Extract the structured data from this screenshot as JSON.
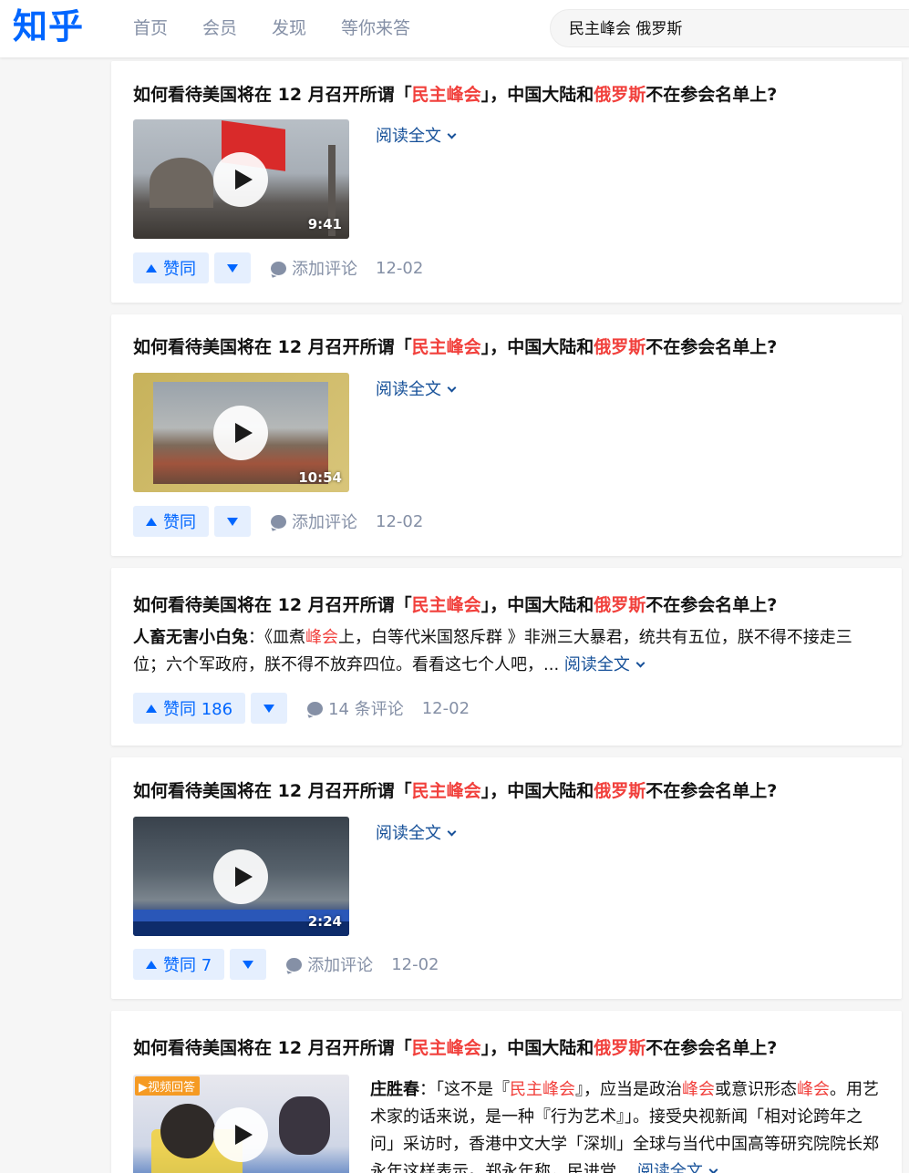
{
  "header": {
    "logo": "知乎",
    "nav": [
      "首页",
      "会员",
      "发现",
      "等你来答"
    ],
    "search_value": "民主峰会 俄罗斯"
  },
  "title_parts": {
    "pre": "如何看待美国将在 12 月召开所谓「",
    "hl1": "民主峰会",
    "mid": "」，中国大陆和",
    "hl2": "俄罗斯",
    "post": "不在参会名单上?"
  },
  "cards": [
    {
      "duration": "9:41",
      "read_more": "阅读全文",
      "vote_label": "赞同",
      "comment_label": "添加评论",
      "date": "12-02"
    },
    {
      "duration": "10:54",
      "read_more": "阅读全文",
      "vote_label": "赞同",
      "comment_label": "添加评论",
      "date": "12-02"
    },
    {
      "author": "人畜无害小白兔",
      "excerpt": {
        "p1": "：《皿煮",
        "hl": "峰会",
        "p2": "上，白等代米国怒斥群 》非洲三大暴君，统共有五位，朕不得不接走三位；六个军政府，朕不得不放弃四位。看看这七个人吧，... "
      },
      "read_more": "阅读全文",
      "vote_label": "赞同 186",
      "comment_label": "14 条评论",
      "date": "12-02"
    },
    {
      "duration": "2:24",
      "read_more": "阅读全文",
      "vote_label": "赞同 7",
      "comment_label": "添加评论",
      "date": "12-02"
    },
    {
      "badge": "视频回答",
      "author": "庄胜春",
      "excerpt": {
        "p1": "：「这不是『",
        "hl1": "民主峰会",
        "p2": "』，应当是政治",
        "hl2": "峰会",
        "p3": "或意识形态",
        "hl3": "峰会",
        "p4": "。用艺术家的话来说，是一种『行为艺术』」。接受央视新闻「相对论跨年之问」采访时，香港中文大学「深圳」全球与当代中国高等研究院院长郑永年这样表示。郑永年称，民进党... "
      },
      "read_more": "阅读全文"
    }
  ],
  "colors": {
    "brand": "#0066ff",
    "highlight": "#f1403c",
    "link": "#175199",
    "muted": "#8590a6"
  }
}
